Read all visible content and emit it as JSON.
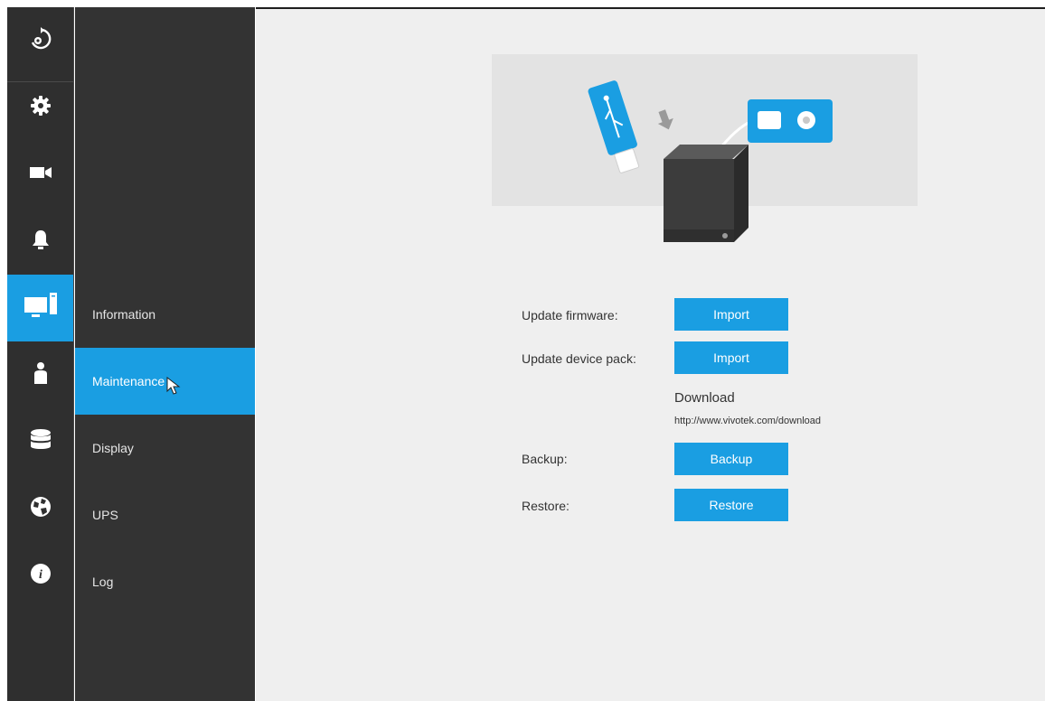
{
  "rail": {
    "items": [
      {
        "icon": "playback-icon"
      },
      {
        "icon": "gear-icon"
      },
      {
        "icon": "camera-icon"
      },
      {
        "icon": "bell-icon"
      },
      {
        "icon": "system-icon",
        "active": true
      },
      {
        "icon": "user-icon"
      },
      {
        "icon": "storage-icon"
      },
      {
        "icon": "network-icon"
      },
      {
        "icon": "info-icon"
      }
    ]
  },
  "subnav": {
    "items": [
      {
        "label": "Information"
      },
      {
        "label": "Maintenance",
        "active": true
      },
      {
        "label": "Display"
      },
      {
        "label": "UPS"
      },
      {
        "label": "Log"
      }
    ]
  },
  "maintenance": {
    "update_firmware_label": "Update firmware:",
    "update_firmware_button": "Import",
    "update_device_pack_label": "Update device pack:",
    "update_device_pack_button": "Import",
    "download_title": "Download",
    "download_url": "http://www.vivotek.com/download",
    "backup_label": "Backup:",
    "backup_button": "Backup",
    "restore_label": "Restore:",
    "restore_button": "Restore"
  },
  "colors": {
    "accent": "#1a9ee2",
    "rail_bg": "#2f2f2f",
    "subnav_bg": "#333333",
    "main_bg": "#efefef"
  }
}
